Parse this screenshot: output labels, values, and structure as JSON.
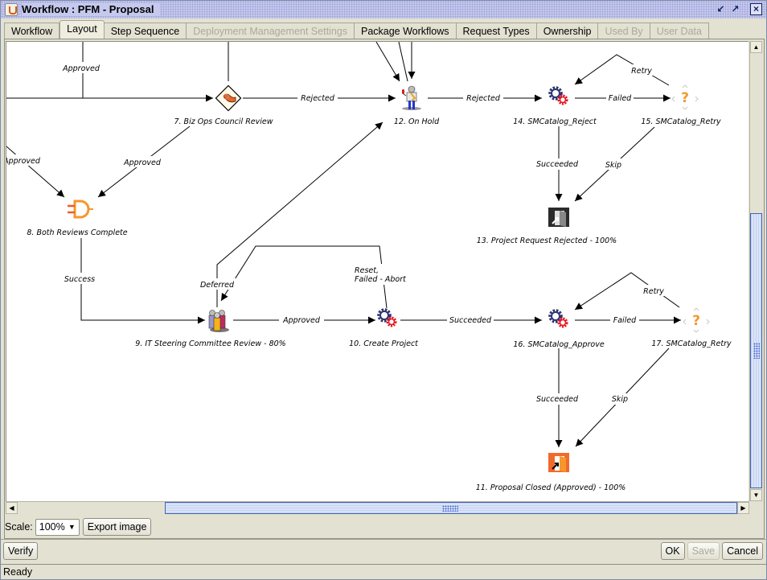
{
  "window": {
    "title": "Workflow : PFM - Proposal",
    "controls": [
      "minimize-icon",
      "maximize-icon",
      "close-icon"
    ]
  },
  "tabs": [
    {
      "label": "Workflow",
      "state": "normal"
    },
    {
      "label": "Layout",
      "state": "active"
    },
    {
      "label": "Step Sequence",
      "state": "normal"
    },
    {
      "label": "Deployment Management Settings",
      "state": "disabled"
    },
    {
      "label": "Package Workflows",
      "state": "normal"
    },
    {
      "label": "Request Types",
      "state": "normal"
    },
    {
      "label": "Ownership",
      "state": "normal"
    },
    {
      "label": "Used By",
      "state": "disabled"
    },
    {
      "label": "User Data",
      "state": "disabled"
    }
  ],
  "diagram": {
    "nodes": [
      {
        "id": "n7",
        "label": "7. Biz Ops Council Review",
        "icon": "decision-review-icon"
      },
      {
        "id": "n8",
        "label": "8. Both Reviews Complete",
        "icon": "and-gate-icon"
      },
      {
        "id": "n9",
        "label": "9. IT Steering Committee Review - 80%",
        "icon": "committee-people-icon"
      },
      {
        "id": "n10",
        "label": "10. Create Project",
        "icon": "gears-icon"
      },
      {
        "id": "n11",
        "label": "11. Proposal Closed (Approved) - 100%",
        "icon": "close-approved-exit-icon"
      },
      {
        "id": "n12",
        "label": "12. On Hold",
        "icon": "on-hold-person-icon"
      },
      {
        "id": "n13",
        "label": "13. Project Request Rejected - 100%",
        "icon": "close-rejected-exit-icon"
      },
      {
        "id": "n14",
        "label": "14. SMCatalog_Reject",
        "icon": "gears-icon"
      },
      {
        "id": "n15",
        "label": "15. SMCatalog_Retry",
        "icon": "question-condition-icon"
      },
      {
        "id": "n16",
        "label": "16. SMCatalog_Approve",
        "icon": "gears-icon"
      },
      {
        "id": "n17",
        "label": "17. SMCatalog_Retry",
        "icon": "question-condition-icon"
      }
    ],
    "edges": [
      {
        "from": "offscreen-top-left",
        "to": "n7",
        "label": "Approved"
      },
      {
        "from": "n7",
        "to": "n12",
        "label": "Rejected"
      },
      {
        "from": "n7",
        "to": "n8",
        "label": "Approved"
      },
      {
        "from": "offscreen-left",
        "to": "n8",
        "label": "Approved"
      },
      {
        "from": "n8",
        "to": "n9",
        "label": "Success"
      },
      {
        "from": "n9",
        "to": "n12",
        "label": "Deferred"
      },
      {
        "from": "n9",
        "to": "n10",
        "label": "Approved"
      },
      {
        "from": "n10",
        "to": "n9",
        "label": "Reset,\nFailed - Abort"
      },
      {
        "from": "n10",
        "to": "n16",
        "label": "Succeeded"
      },
      {
        "from": "n12",
        "to": "n14",
        "label": "Rejected"
      },
      {
        "from": "n14",
        "to": "n15",
        "label": "Failed"
      },
      {
        "from": "n15",
        "to": "n14",
        "label": "Retry"
      },
      {
        "from": "n14",
        "to": "n13",
        "label": "Succeeded"
      },
      {
        "from": "n15",
        "to": "n13",
        "label": "Skip"
      },
      {
        "from": "n16",
        "to": "n17",
        "label": "Failed"
      },
      {
        "from": "n17",
        "to": "n16",
        "label": "Retry"
      },
      {
        "from": "n16",
        "to": "n11",
        "label": "Succeeded"
      },
      {
        "from": "n17",
        "to": "n11",
        "label": "Skip"
      }
    ]
  },
  "toolbar": {
    "scale_label": "Scale:",
    "scale_value": "100%",
    "export_label": "Export image"
  },
  "footer": {
    "verify_label": "Verify",
    "ok_label": "OK",
    "save_label": "Save",
    "cancel_label": "Cancel"
  },
  "status": {
    "text": "Ready"
  },
  "colors": {
    "title_bar": "#c6c9ee",
    "background": "#e3e2d2",
    "scroll_thumb_border": "#3f63b4",
    "gear_blue": "#2e3472",
    "gear_red": "#e8141e",
    "orange_accent": "#f5972d"
  }
}
